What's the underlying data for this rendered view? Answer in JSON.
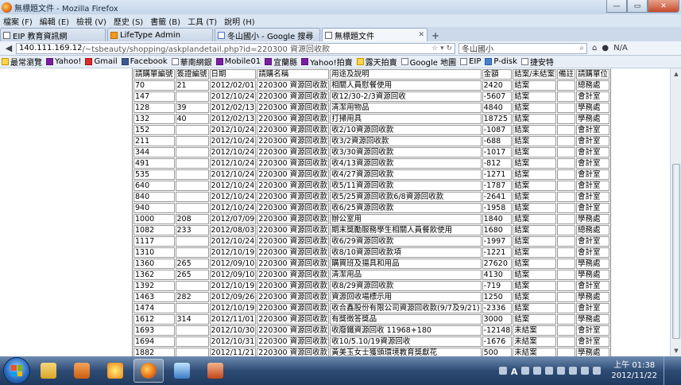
{
  "window": {
    "title": "無標題文件 - Mozilla Firefox",
    "minimize": "—",
    "maximize": "▭",
    "close": "✕"
  },
  "menu": [
    "檔案 (F)",
    "編輯 (E)",
    "檢視 (V)",
    "歷史 (S)",
    "書籤 (B)",
    "工具 (T)",
    "說明 (H)"
  ],
  "tabs": [
    {
      "label": "EIP 教育資訊網",
      "icon": "page-icon"
    },
    {
      "label": "LifeType Admin",
      "icon": "lifetype-icon"
    },
    {
      "label": "冬山國小 - Google 搜尋",
      "icon": "google-icon"
    },
    {
      "label": "無標題文件",
      "icon": "page-icon"
    }
  ],
  "new_tab": "+",
  "nav": {
    "url_host": "140.111.169.12",
    "url_rest": "/~tsbeauty/shopping/askplandetail.php?id=220300 資源回收款",
    "search_value": "冬山國小",
    "na_label": "N/A"
  },
  "bookmarks": [
    {
      "label": "最常瀏覽",
      "icon": "star-icon"
    },
    {
      "label": "Yahoo!",
      "icon": "yahoo-icon"
    },
    {
      "label": "Gmail",
      "icon": "gmail-icon"
    },
    {
      "label": "Facebook",
      "icon": "facebook-icon"
    },
    {
      "label": "華南網銀",
      "icon": "page-icon"
    },
    {
      "label": "Mobile01",
      "icon": "yahoo-icon"
    },
    {
      "label": "宜蘭縣",
      "icon": "yahoo-icon"
    },
    {
      "label": "Yahoo!拍賣",
      "icon": "yahoo-icon"
    },
    {
      "label": "露天拍賣",
      "icon": "star-icon"
    },
    {
      "label": "Google 地圖",
      "icon": "page-icon"
    },
    {
      "label": "EIP",
      "icon": "page-icon"
    },
    {
      "label": "P-disk",
      "icon": "blue-icon"
    },
    {
      "label": "捷安特",
      "icon": "page-icon"
    }
  ],
  "table": {
    "headers": [
      "請購單編號",
      "簽證編號",
      "日期",
      "請購名稱",
      "用途及說明",
      "金額",
      "結案/未結案",
      "備註",
      "請購單位"
    ],
    "rows": [
      [
        "70",
        "21",
        "2012/02/01",
        "220300 資源回收款",
        "相關人員慰餐使用",
        "2420",
        "結案",
        "",
        "總務處"
      ],
      [
        "147",
        "",
        "2012/10/24",
        "220300 資源回收款",
        "收12/30-2/3資源回收",
        "-5607",
        "結案",
        "",
        "會計室"
      ],
      [
        "128",
        "39",
        "2012/02/13",
        "220300 資源回收款",
        "清潔用物品",
        "4840",
        "結案",
        "",
        "學務處"
      ],
      [
        "132",
        "40",
        "2012/02/13",
        "220300 資源回收款",
        "打掃用具",
        "18725",
        "結案",
        "",
        "學務處"
      ],
      [
        "152",
        "",
        "2012/10/24",
        "220300 資源回收款",
        "收2/10資源回收款",
        "-1087",
        "結案",
        "",
        "會計室"
      ],
      [
        "211",
        "",
        "2012/10/24",
        "220300 資源回收款",
        "收3/2資源回收款",
        "-688",
        "結案",
        "",
        "會計室"
      ],
      [
        "344",
        "",
        "2012/10/24",
        "220300 資源回收款",
        "收3/30資源回收款",
        "-1017",
        "結案",
        "",
        "會計室"
      ],
      [
        "491",
        "",
        "2012/10/24",
        "220300 資源回收款",
        "收4/13資源回收款",
        "-812",
        "結案",
        "",
        "會計室"
      ],
      [
        "535",
        "",
        "2012/10/24",
        "220300 資源回收款",
        "收4/27資源回收款",
        "-1271",
        "結案",
        "",
        "會計室"
      ],
      [
        "640",
        "",
        "2012/10/24",
        "220300 資源回收款",
        "收5/11資源回收款",
        "-1787",
        "結案",
        "",
        "會計室"
      ],
      [
        "840",
        "",
        "2012/10/24",
        "220300 資源回收款",
        "收5/25資源回收款6/8資源回收款",
        "-2641",
        "結案",
        "",
        "會計室"
      ],
      [
        "940",
        "",
        "2012/10/24",
        "220300 資源回收款",
        "收6/25資源回收款",
        "-1958",
        "結案",
        "",
        "會計室"
      ],
      [
        "1000",
        "208",
        "2012/07/09",
        "220300 資源回收款",
        "辦公室用",
        "1840",
        "結案",
        "",
        "學務處"
      ],
      [
        "1082",
        "233",
        "2012/08/03",
        "220300 資源回收款",
        "期末獎勵服務學生相關人員餐飲使用",
        "1680",
        "結案",
        "",
        "總務處"
      ],
      [
        "1117",
        "",
        "2012/10/24",
        "220300 資源回收款",
        "收6/29資源回收款",
        "-1997",
        "結案",
        "",
        "會計室"
      ],
      [
        "1310",
        "",
        "2012/10/19",
        "220300 資源回收款",
        "收8/10資源回收款項",
        "-1221",
        "結案",
        "",
        "會計室"
      ],
      [
        "1360",
        "265",
        "2012/09/10",
        "220300 資源回收款",
        "購買班及揚具和用品",
        "27620",
        "結案",
        "",
        "學務處"
      ],
      [
        "1362",
        "265",
        "2012/09/10",
        "220300 資源回收款",
        "清潔用品",
        "4130",
        "結案",
        "",
        "學務處"
      ],
      [
        "1392",
        "",
        "2012/10/19",
        "220300 資源回收款",
        "收8/29資源回收款",
        "-719",
        "結案",
        "",
        "會計室"
      ],
      [
        "1463",
        "282",
        "2012/09/26",
        "220300 資源回收款",
        "資源回收場標示用",
        "1250",
        "結案",
        "",
        "學務處"
      ],
      [
        "1474",
        "",
        "2012/10/19",
        "220300 資源回收款",
        "收合鑫股份有限公司資源回收款(9/7及9/21)",
        "-2336",
        "結案",
        "",
        "會計室"
      ],
      [
        "1612",
        "314",
        "2012/11/01",
        "220300 資源回收款",
        "有獎徵答獎品",
        "3000",
        "結案",
        "",
        "學務處"
      ],
      [
        "1693",
        "",
        "2012/10/30",
        "220300 資源回收款",
        "收廢鐵資源回收 11968+180",
        "-12148",
        "未結案",
        "",
        "會計室"
      ],
      [
        "1694",
        "",
        "2012/10/31",
        "220300 資源回收款",
        "收10/5.10/19資源回收",
        "-1676",
        "未結案",
        "",
        "會計室"
      ],
      [
        "1882",
        "",
        "2012/11/21",
        "220300 資源回收款",
        "黃美玉女士獲頒環境教育獎獻花",
        "500",
        "未結案",
        "",
        "學務處"
      ]
    ]
  },
  "taskbar": {
    "clock_time": "上午 01:38",
    "clock_date": "2012/11/22",
    "ime_label": "A"
  }
}
